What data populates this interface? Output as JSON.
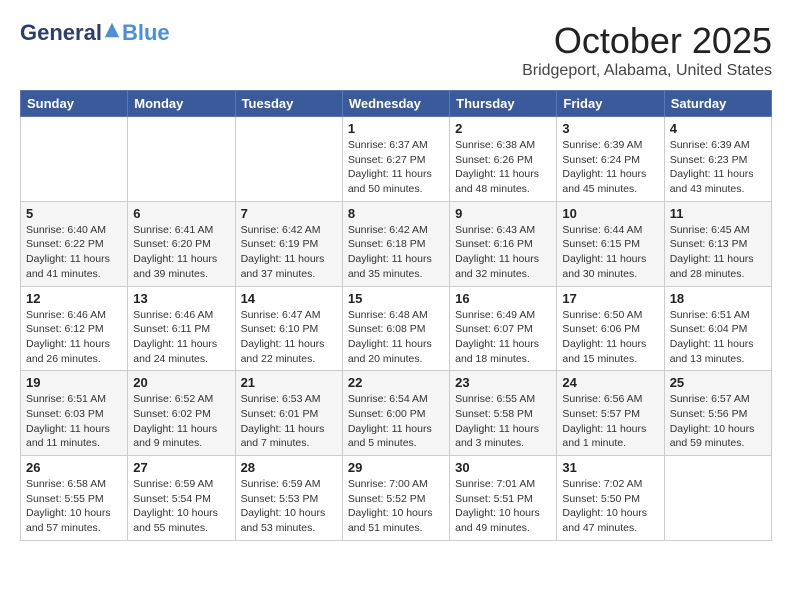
{
  "header": {
    "logo_general": "General",
    "logo_blue": "Blue",
    "month": "October 2025",
    "location": "Bridgeport, Alabama, United States"
  },
  "weekdays": [
    "Sunday",
    "Monday",
    "Tuesday",
    "Wednesday",
    "Thursday",
    "Friday",
    "Saturday"
  ],
  "weeks": [
    [
      {
        "day": "",
        "info": ""
      },
      {
        "day": "",
        "info": ""
      },
      {
        "day": "",
        "info": ""
      },
      {
        "day": "1",
        "info": "Sunrise: 6:37 AM\nSunset: 6:27 PM\nDaylight: 11 hours\nand 50 minutes."
      },
      {
        "day": "2",
        "info": "Sunrise: 6:38 AM\nSunset: 6:26 PM\nDaylight: 11 hours\nand 48 minutes."
      },
      {
        "day": "3",
        "info": "Sunrise: 6:39 AM\nSunset: 6:24 PM\nDaylight: 11 hours\nand 45 minutes."
      },
      {
        "day": "4",
        "info": "Sunrise: 6:39 AM\nSunset: 6:23 PM\nDaylight: 11 hours\nand 43 minutes."
      }
    ],
    [
      {
        "day": "5",
        "info": "Sunrise: 6:40 AM\nSunset: 6:22 PM\nDaylight: 11 hours\nand 41 minutes."
      },
      {
        "day": "6",
        "info": "Sunrise: 6:41 AM\nSunset: 6:20 PM\nDaylight: 11 hours\nand 39 minutes."
      },
      {
        "day": "7",
        "info": "Sunrise: 6:42 AM\nSunset: 6:19 PM\nDaylight: 11 hours\nand 37 minutes."
      },
      {
        "day": "8",
        "info": "Sunrise: 6:42 AM\nSunset: 6:18 PM\nDaylight: 11 hours\nand 35 minutes."
      },
      {
        "day": "9",
        "info": "Sunrise: 6:43 AM\nSunset: 6:16 PM\nDaylight: 11 hours\nand 32 minutes."
      },
      {
        "day": "10",
        "info": "Sunrise: 6:44 AM\nSunset: 6:15 PM\nDaylight: 11 hours\nand 30 minutes."
      },
      {
        "day": "11",
        "info": "Sunrise: 6:45 AM\nSunset: 6:13 PM\nDaylight: 11 hours\nand 28 minutes."
      }
    ],
    [
      {
        "day": "12",
        "info": "Sunrise: 6:46 AM\nSunset: 6:12 PM\nDaylight: 11 hours\nand 26 minutes."
      },
      {
        "day": "13",
        "info": "Sunrise: 6:46 AM\nSunset: 6:11 PM\nDaylight: 11 hours\nand 24 minutes."
      },
      {
        "day": "14",
        "info": "Sunrise: 6:47 AM\nSunset: 6:10 PM\nDaylight: 11 hours\nand 22 minutes."
      },
      {
        "day": "15",
        "info": "Sunrise: 6:48 AM\nSunset: 6:08 PM\nDaylight: 11 hours\nand 20 minutes."
      },
      {
        "day": "16",
        "info": "Sunrise: 6:49 AM\nSunset: 6:07 PM\nDaylight: 11 hours\nand 18 minutes."
      },
      {
        "day": "17",
        "info": "Sunrise: 6:50 AM\nSunset: 6:06 PM\nDaylight: 11 hours\nand 15 minutes."
      },
      {
        "day": "18",
        "info": "Sunrise: 6:51 AM\nSunset: 6:04 PM\nDaylight: 11 hours\nand 13 minutes."
      }
    ],
    [
      {
        "day": "19",
        "info": "Sunrise: 6:51 AM\nSunset: 6:03 PM\nDaylight: 11 hours\nand 11 minutes."
      },
      {
        "day": "20",
        "info": "Sunrise: 6:52 AM\nSunset: 6:02 PM\nDaylight: 11 hours\nand 9 minutes."
      },
      {
        "day": "21",
        "info": "Sunrise: 6:53 AM\nSunset: 6:01 PM\nDaylight: 11 hours\nand 7 minutes."
      },
      {
        "day": "22",
        "info": "Sunrise: 6:54 AM\nSunset: 6:00 PM\nDaylight: 11 hours\nand 5 minutes."
      },
      {
        "day": "23",
        "info": "Sunrise: 6:55 AM\nSunset: 5:58 PM\nDaylight: 11 hours\nand 3 minutes."
      },
      {
        "day": "24",
        "info": "Sunrise: 6:56 AM\nSunset: 5:57 PM\nDaylight: 11 hours\nand 1 minute."
      },
      {
        "day": "25",
        "info": "Sunrise: 6:57 AM\nSunset: 5:56 PM\nDaylight: 10 hours\nand 59 minutes."
      }
    ],
    [
      {
        "day": "26",
        "info": "Sunrise: 6:58 AM\nSunset: 5:55 PM\nDaylight: 10 hours\nand 57 minutes."
      },
      {
        "day": "27",
        "info": "Sunrise: 6:59 AM\nSunset: 5:54 PM\nDaylight: 10 hours\nand 55 minutes."
      },
      {
        "day": "28",
        "info": "Sunrise: 6:59 AM\nSunset: 5:53 PM\nDaylight: 10 hours\nand 53 minutes."
      },
      {
        "day": "29",
        "info": "Sunrise: 7:00 AM\nSunset: 5:52 PM\nDaylight: 10 hours\nand 51 minutes."
      },
      {
        "day": "30",
        "info": "Sunrise: 7:01 AM\nSunset: 5:51 PM\nDaylight: 10 hours\nand 49 minutes."
      },
      {
        "day": "31",
        "info": "Sunrise: 7:02 AM\nSunset: 5:50 PM\nDaylight: 10 hours\nand 47 minutes."
      },
      {
        "day": "",
        "info": ""
      }
    ]
  ]
}
